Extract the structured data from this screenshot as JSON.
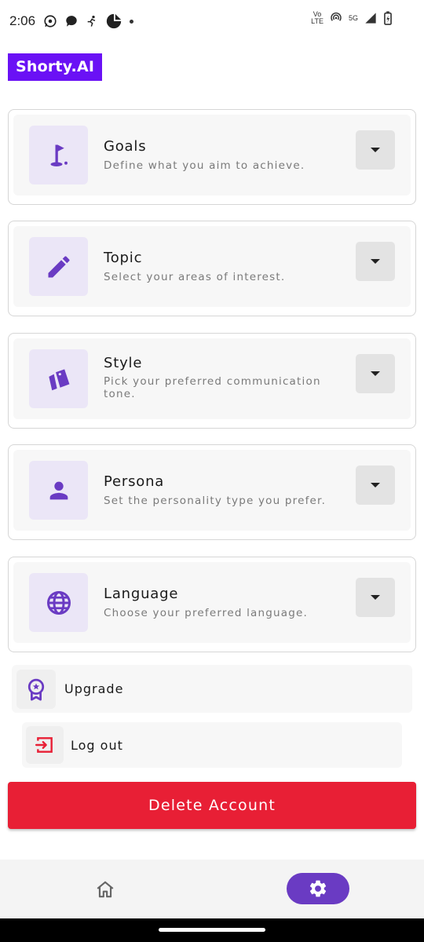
{
  "status_bar": {
    "time": "2:06",
    "volte_top": "Vo",
    "volte_bottom": "LTE",
    "network": "5G"
  },
  "brand": {
    "name": "Shorty.AI"
  },
  "settings": [
    {
      "title": "Goals",
      "subtitle": "Define what you aim to achieve.",
      "icon": "golf-flag-icon"
    },
    {
      "title": "Topic",
      "subtitle": "Select your areas of interest.",
      "icon": "pencil-icon"
    },
    {
      "title": "Style",
      "subtitle": "Pick your preferred communication tone.",
      "icon": "style-cards-icon"
    },
    {
      "title": "Persona",
      "subtitle": "Set the personality type you prefer.",
      "icon": "person-icon"
    },
    {
      "title": "Language",
      "subtitle": "Choose your preferred language.",
      "icon": "globe-icon"
    }
  ],
  "actions": {
    "upgrade_label": "Upgrade",
    "logout_label": "Log out",
    "delete_label": "Delete Account"
  },
  "bottom_nav": {
    "items": [
      {
        "icon": "home-icon",
        "active": false
      },
      {
        "icon": "gear-icon",
        "active": true
      }
    ]
  },
  "colors": {
    "brand": "#6a11f5",
    "accent": "#6a3bc3",
    "danger": "#e81f35",
    "icon_tile": "#ebe6f7"
  }
}
